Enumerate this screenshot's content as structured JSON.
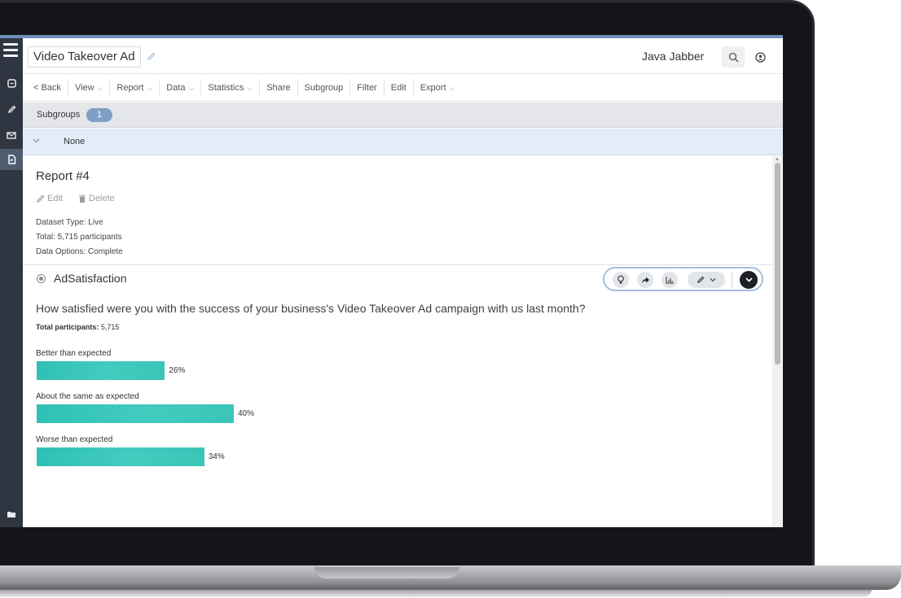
{
  "header": {
    "title": "Video Takeover Ad",
    "user": "Java Jabber"
  },
  "menu": [
    {
      "label": "< Back",
      "dropdown": false
    },
    {
      "label": "View",
      "dropdown": true
    },
    {
      "label": "Report",
      "dropdown": true
    },
    {
      "label": "Data",
      "dropdown": true
    },
    {
      "label": "Statistics",
      "dropdown": true
    },
    {
      "label": "Share",
      "dropdown": false
    },
    {
      "label": "Subgroup",
      "dropdown": false
    },
    {
      "label": "Filter",
      "dropdown": false
    },
    {
      "label": "Edit",
      "dropdown": false
    },
    {
      "label": "Export",
      "dropdown": true
    }
  ],
  "subgroups": {
    "label": "Subgroups",
    "count": "1",
    "selected": "None"
  },
  "report": {
    "title": "Report #4",
    "edit_label": "Edit",
    "delete_label": "Delete",
    "dataset_type": "Dataset Type: Live",
    "total": "Total: 5,715 participants",
    "data_options": "Data Options: Complete"
  },
  "question": {
    "name": "AdSatisfaction",
    "text": "How satisfied were you with the success of your business's Video Takeover Ad campaign with us last month?",
    "total_label": "Total participants:",
    "total_value": "5,715"
  },
  "chart_data": {
    "type": "bar",
    "orientation": "horizontal",
    "categories": [
      "Better than expected",
      "About the same as expected",
      "Worse than expected"
    ],
    "values": [
      26,
      40,
      34
    ],
    "value_labels": [
      "26%",
      "40%",
      "34%"
    ],
    "unit": "%",
    "color": "#3ec6ba"
  },
  "icons": {
    "rail": [
      "menu-icon",
      "survey-icon",
      "edit-icon",
      "mail-icon",
      "report-icon",
      "folder-icon"
    ],
    "toolbar": [
      "search-icon",
      "account-icon"
    ],
    "question_tools": [
      "lightbulb-icon",
      "share-icon",
      "chart-icon",
      "pencil-icon",
      "expand-icon"
    ]
  }
}
